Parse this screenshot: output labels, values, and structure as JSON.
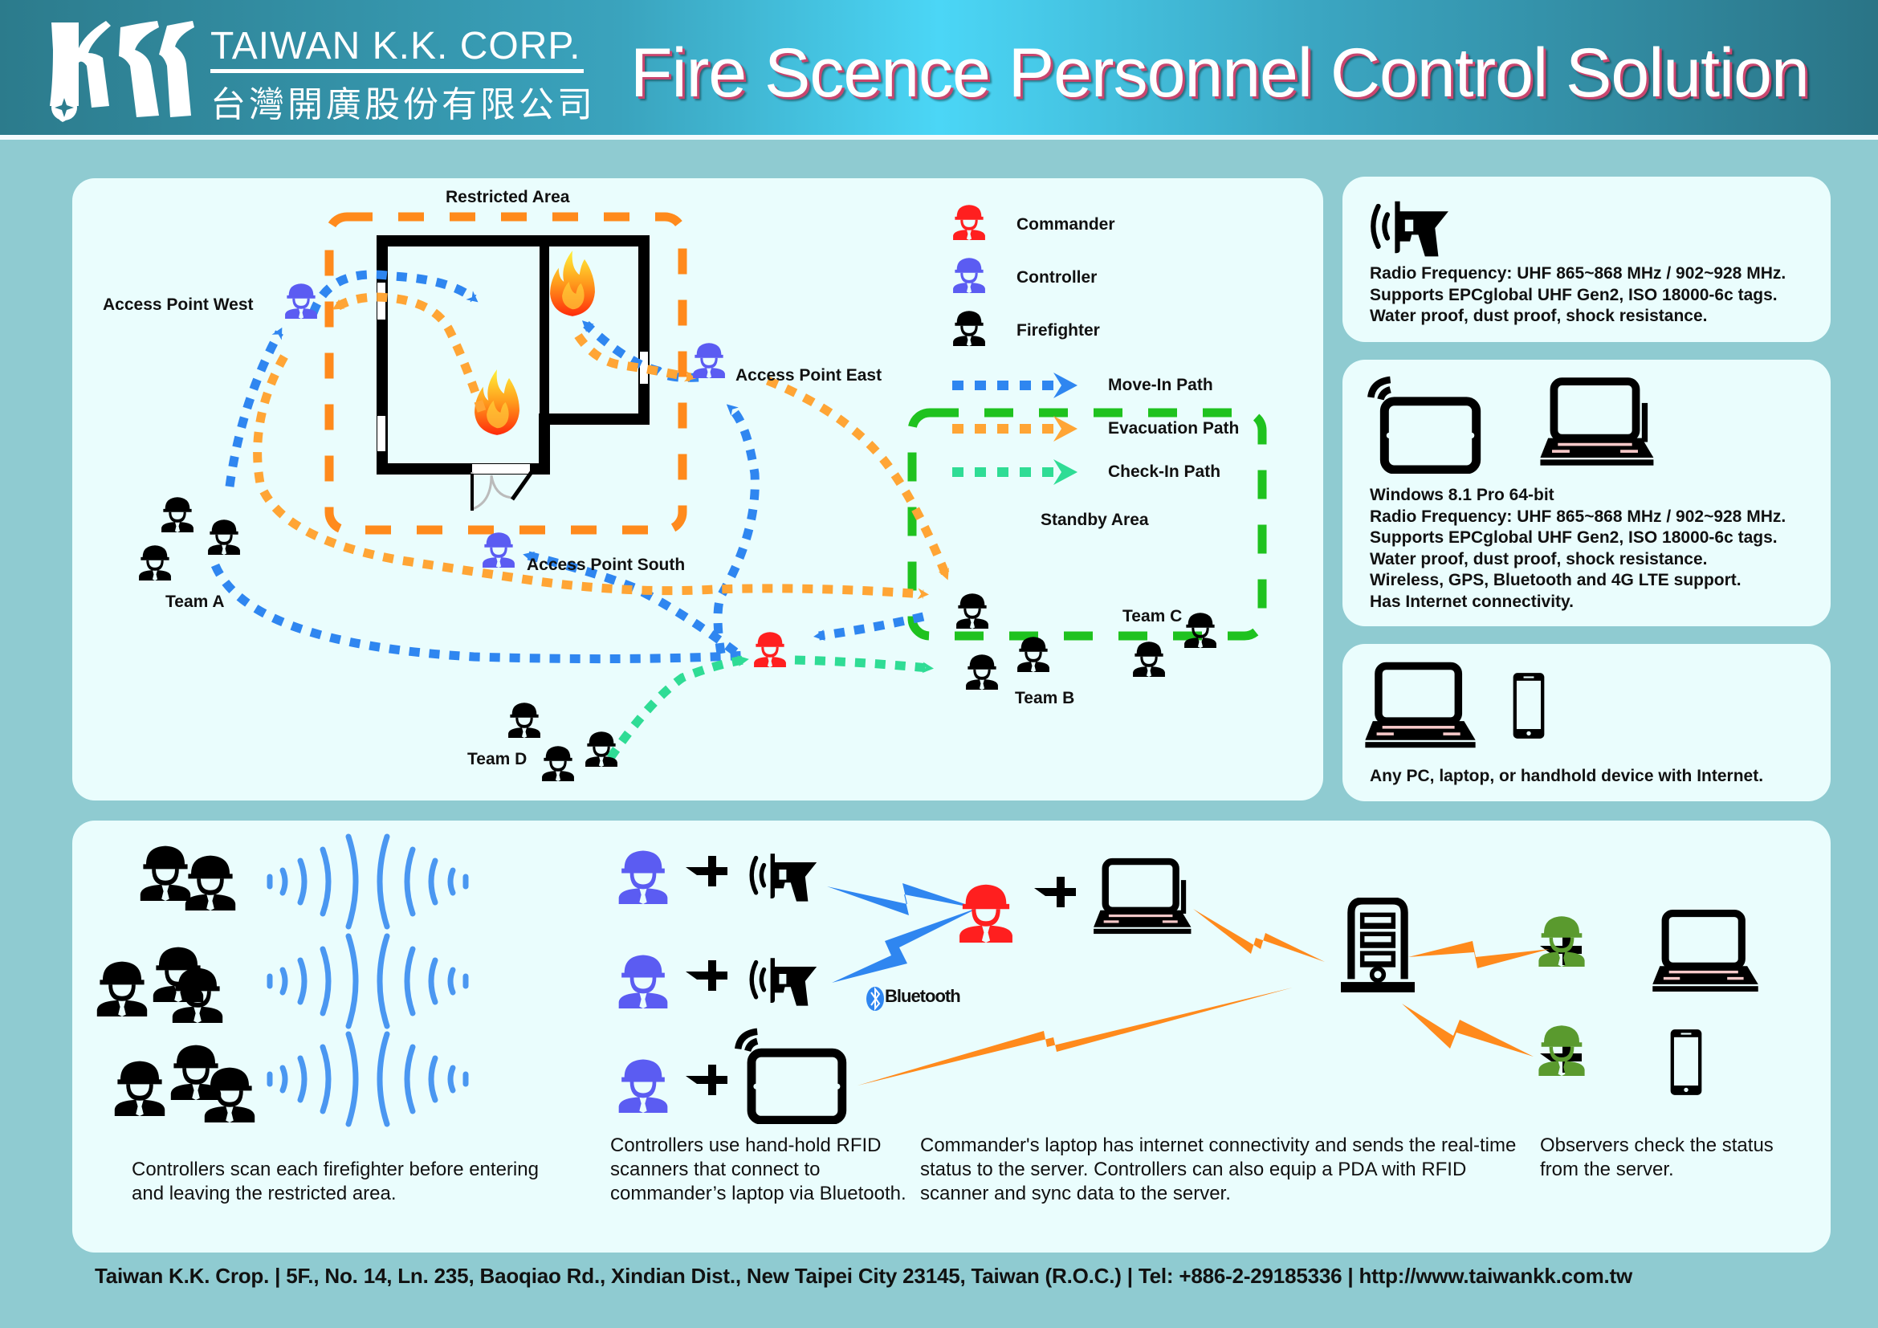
{
  "header": {
    "brand_en": "TAIWAN K.K. CORP.",
    "brand_zh": "台灣開廣股份有限公司",
    "title": "Fire Scence Personnel Control Solution",
    "logo_icon": "kk-logo-icon"
  },
  "colors": {
    "commander": "#ff1f1f",
    "controller": "#5b5cf2",
    "firefighter": "#000000",
    "observer": "#5a9a2e",
    "move_in_path": "#2f86f0",
    "evacuation_path": "#ffa535",
    "check_in_path": "#2fdc95",
    "restricted_area": "#ff8a1c",
    "standby_area": "#1fc21f",
    "panel_bg": "#eafdfd",
    "page_bg": "#8fcbd1"
  },
  "map": {
    "restricted_area_label": "Restricted Area",
    "standby_area_label": "Standby Area",
    "access_points": {
      "west": "Access Point West",
      "east": "Access Point East",
      "south": "Access Point South"
    },
    "teams": {
      "a": "Team A",
      "b": "Team B",
      "c": "Team C",
      "d": "Team D"
    },
    "legend": [
      {
        "label": "Commander",
        "icon": "commander-icon"
      },
      {
        "label": "Controller",
        "icon": "controller-icon"
      },
      {
        "label": "Firefighter",
        "icon": "firefighter-icon"
      },
      {
        "label": "Move-In Path",
        "icon": "move-in-arrow"
      },
      {
        "label": "Evacuation Path",
        "icon": "evacuation-arrow"
      },
      {
        "label": "Check-In Path",
        "icon": "check-in-arrow"
      }
    ]
  },
  "specs": [
    {
      "icons": [
        "rfid-scanner-icon"
      ],
      "lines": [
        "Radio Frequency: UHF 865~868 MHz / 902~928 MHz.",
        "Supports EPCglobal UHF Gen2, ISO 18000-6c tags.",
        "Water proof, dust proof, shock resistance."
      ]
    },
    {
      "icons": [
        "tablet-wireless-icon",
        "laptop-antenna-icon"
      ],
      "lines": [
        "Windows 8.1 Pro 64-bit",
        "Radio Frequency: UHF 865~868 MHz / 902~928 MHz.",
        "Supports EPCglobal UHF Gen2, ISO 18000-6c tags.",
        "Water proof, dust proof, shock resistance.",
        "Wireless, GPS, Bluetooth and 4G LTE support.",
        "Has Internet connectivity."
      ]
    },
    {
      "icons": [
        "laptop-icon",
        "smartphone-icon"
      ],
      "lines": [
        "Any PC, laptop, or handhold device with Internet."
      ]
    }
  ],
  "flow": {
    "plus": "+",
    "bluetooth_label": "Bluetooth",
    "captions": [
      "Controllers scan each firefighter before entering and leaving the restricted area.",
      "Controllers use hand-hold RFID scanners that connect to commander’s laptop via Bluetooth.",
      "Commander's laptop has internet connectivity and sends the real-time status to the server. Controllers can also equip a PDA with RFID scanner and sync data to the server.",
      "Observers check the status from the server."
    ]
  },
  "footer": {
    "text": "Taiwan K.K. Crop. | 5F., No. 14, Ln. 235, Baoqiao Rd., Xindian Dist., New Taipei City 23145, Taiwan (R.O.C.) | Tel: +886-2-29185336 | http://www.taiwankk.com.tw"
  }
}
